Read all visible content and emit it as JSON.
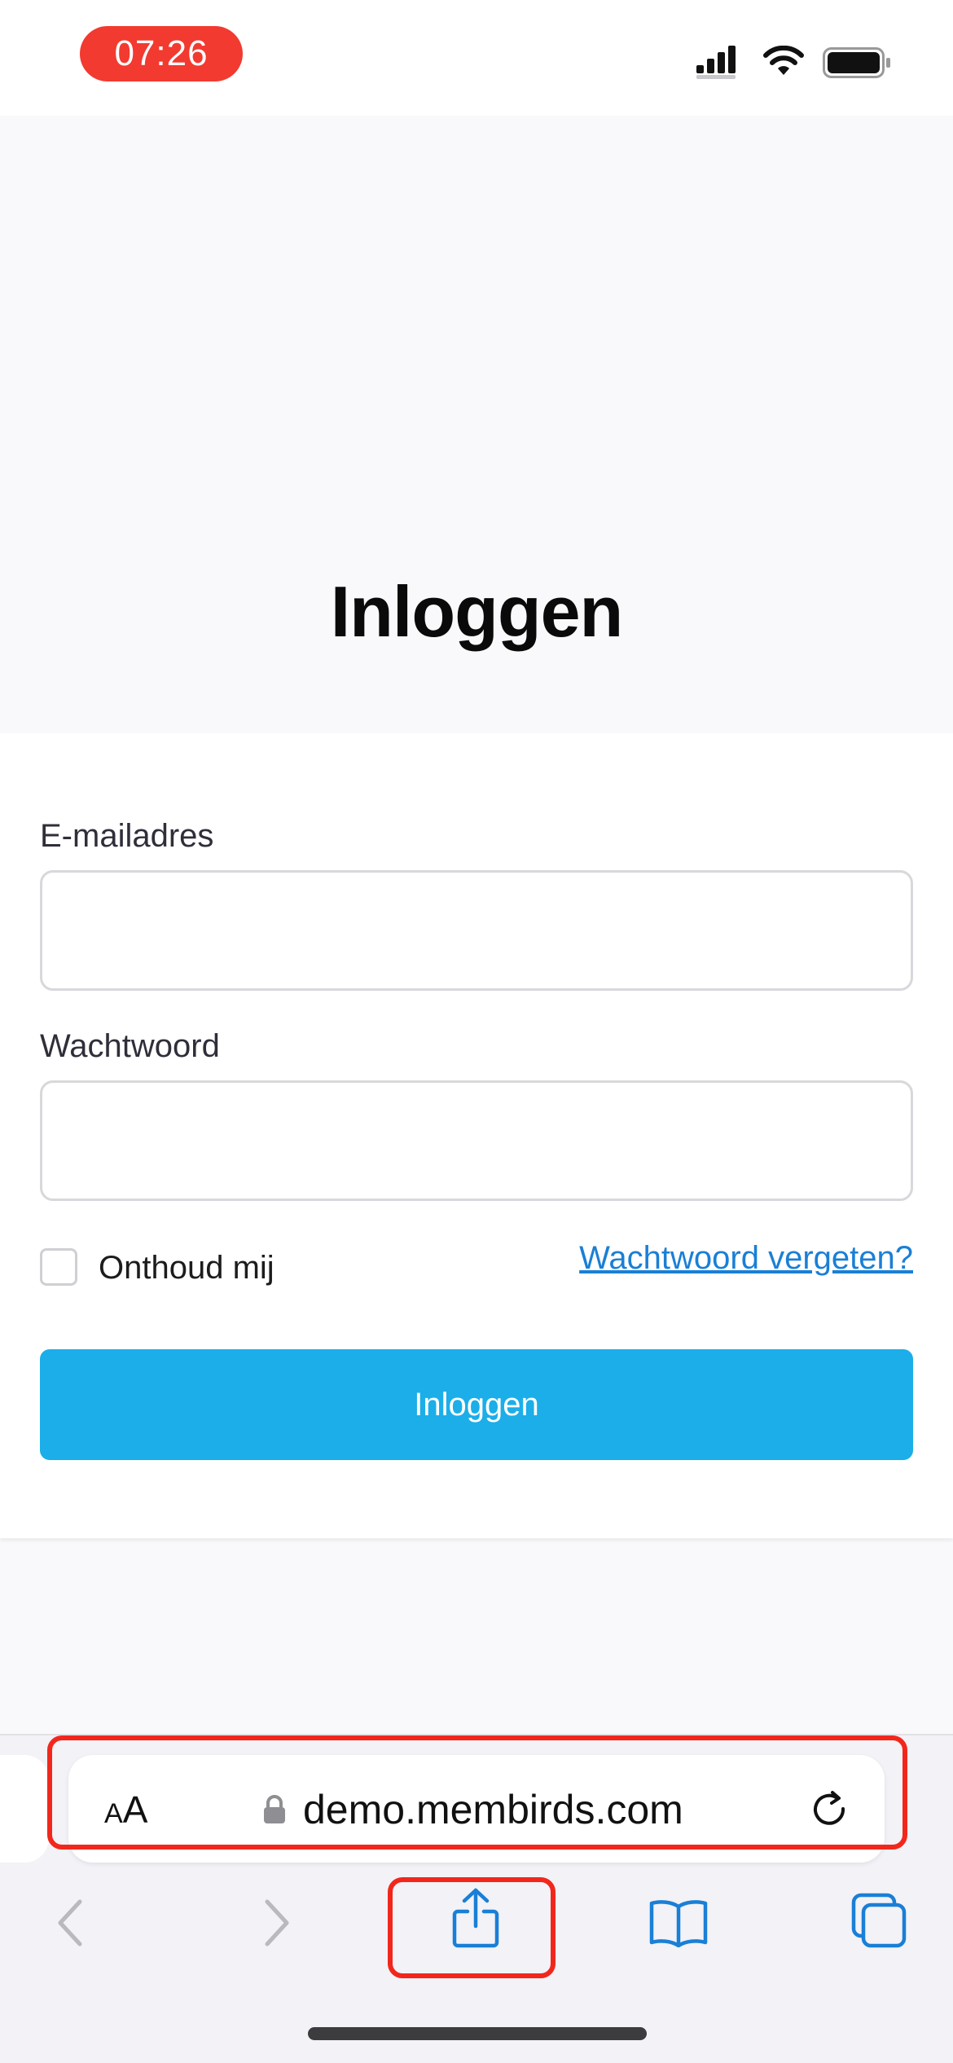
{
  "status_bar": {
    "time": "07:26",
    "time_pill_color": "#f23a30",
    "icons": [
      "signal-icon",
      "wifi-icon",
      "battery-icon"
    ]
  },
  "page": {
    "title": "Inloggen"
  },
  "form": {
    "email_label": "E-mailadres",
    "email_value": "",
    "password_label": "Wachtwoord",
    "password_value": "",
    "remember_label": "Onthoud mij",
    "remember_checked": false,
    "forgot_link": "Wachtwoord vergeten?",
    "submit_label": "Inloggen",
    "accent_color": "#1baee9",
    "link_color": "#1a7fd6"
  },
  "browser": {
    "text_size_small": "A",
    "text_size_big": "A",
    "url": "demo.membirds.com",
    "toolbar_icons": [
      "back-icon",
      "forward-icon",
      "share-icon",
      "bookmarks-icon",
      "tabs-icon"
    ],
    "highlight_color": "#f2271c"
  }
}
